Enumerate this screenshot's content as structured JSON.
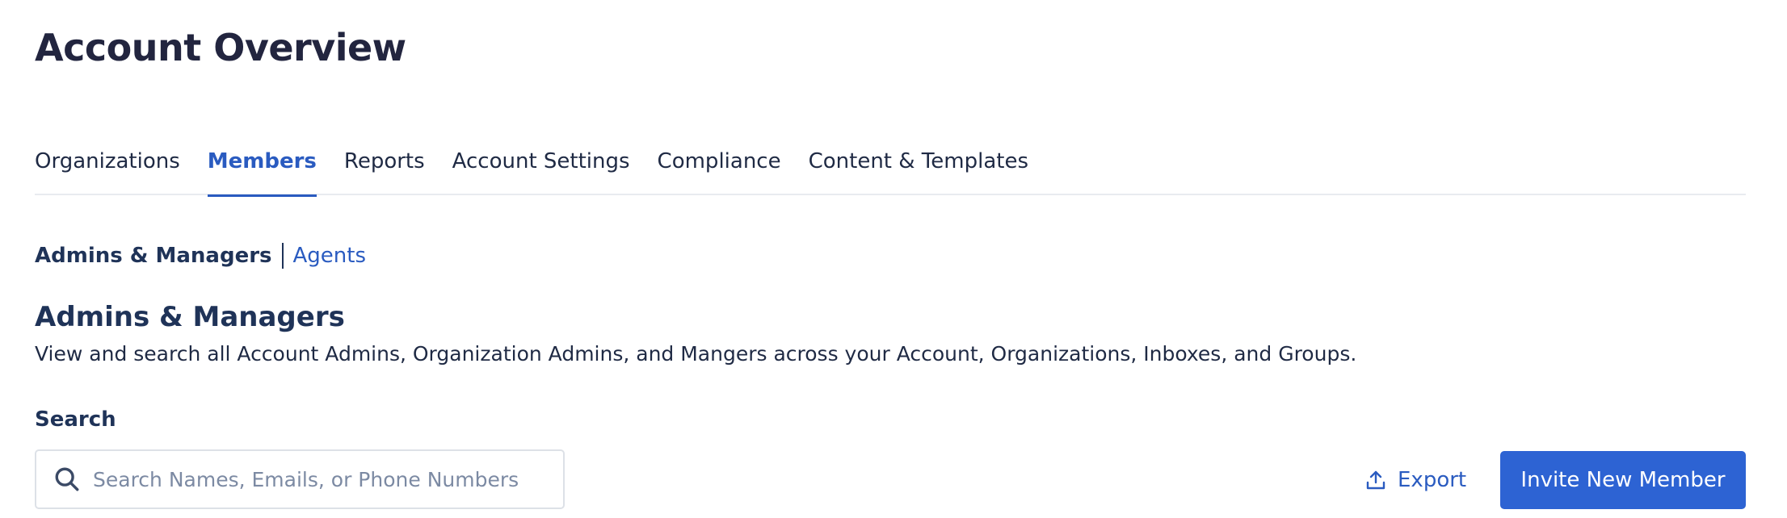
{
  "page": {
    "title": "Account Overview"
  },
  "tabs": [
    {
      "label": "Organizations",
      "active": false
    },
    {
      "label": "Members",
      "active": true
    },
    {
      "label": "Reports",
      "active": false
    },
    {
      "label": "Account Settings",
      "active": false
    },
    {
      "label": "Compliance",
      "active": false
    },
    {
      "label": "Content & Templates",
      "active": false
    }
  ],
  "subnav": {
    "current": "Admins & Managers",
    "link": "Agents"
  },
  "section": {
    "title": "Admins & Managers",
    "description": "View and search all Account Admins, Organization Admins, and Mangers across your Account, Organizations, Inboxes, and Groups."
  },
  "search": {
    "label": "Search",
    "placeholder": "Search Names, Emails, or Phone Numbers",
    "value": "",
    "icon": "search-icon"
  },
  "actions": {
    "export_label": "Export",
    "export_icon": "upload-icon",
    "invite_label": "Invite New Member"
  },
  "colors": {
    "accent": "#2a5bc0",
    "primary_button": "#2d63d3",
    "title": "#22253f",
    "heading": "#1f3358"
  }
}
